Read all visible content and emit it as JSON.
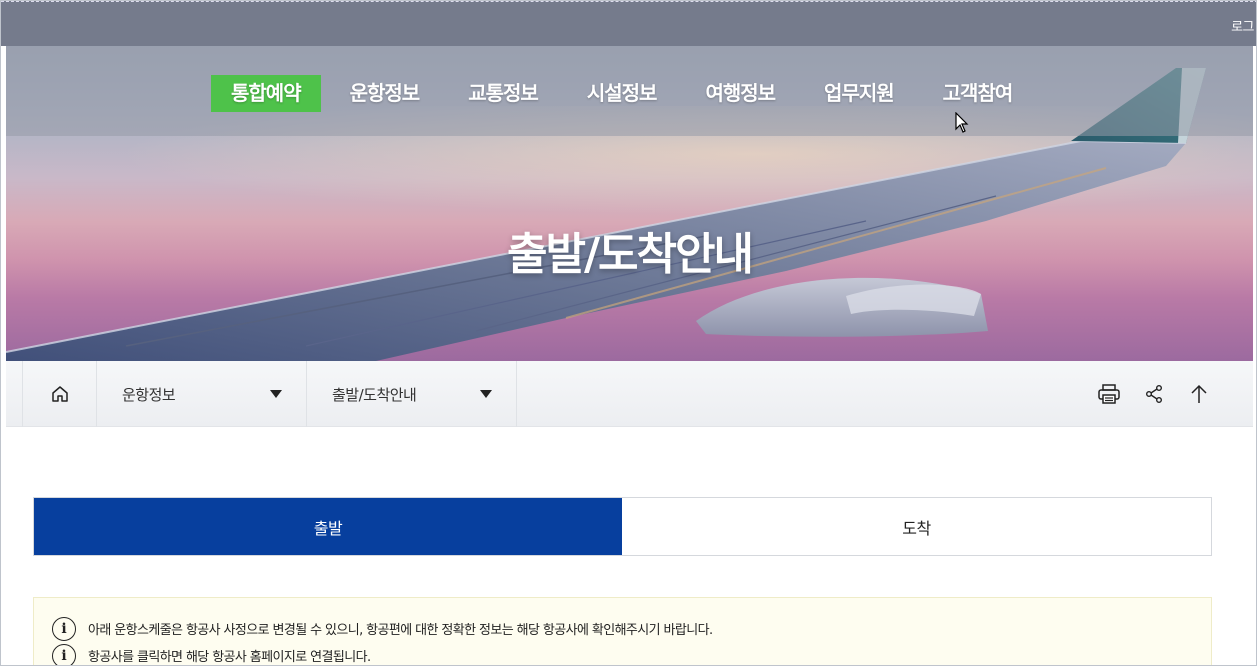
{
  "util": {
    "login_label": "로그"
  },
  "gnb": {
    "items": [
      {
        "label": "통합예약",
        "active": true
      },
      {
        "label": "운항정보",
        "active": false
      },
      {
        "label": "교통정보",
        "active": false
      },
      {
        "label": "시설정보",
        "active": false
      },
      {
        "label": "여행정보",
        "active": false
      },
      {
        "label": "업무지원",
        "active": false
      },
      {
        "label": "고객참여",
        "active": false
      }
    ]
  },
  "hero": {
    "title": "출발/도착안내"
  },
  "breadcrumb": {
    "home_icon": "home-icon",
    "level1": "운항정보",
    "level2": "출발/도착안내",
    "tools": [
      "print-icon",
      "share-icon",
      "arrow-up-icon"
    ]
  },
  "tabs": [
    {
      "label": "출발",
      "selected": true
    },
    {
      "label": "도착",
      "selected": false
    }
  ],
  "notice": {
    "lines": [
      "아래 운항스케줄은 항공사 사정으로 변경될 수 있으니, 항공편에 대한 정확한 정보는 해당 항공사에 확인해주시기 바랍니다.",
      "항공사를 클릭하면 해당 항공사 홈페이지로 연결됩니다."
    ]
  },
  "colors": {
    "active_menu": "#4ec24a",
    "selected_tab": "#073f9e",
    "notice_bg": "#fefdf0"
  }
}
